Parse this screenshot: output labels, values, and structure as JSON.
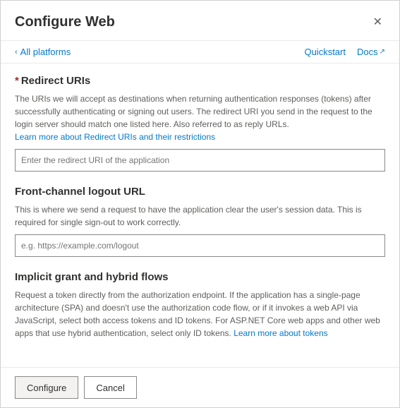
{
  "dialog": {
    "title": "Configure Web",
    "close_label": "✕"
  },
  "nav": {
    "back_chevron": "‹",
    "back_label": "All platforms",
    "quickstart_label": "Quickstart",
    "docs_label": "Docs",
    "external_icon": "↗"
  },
  "sections": {
    "redirect_uris": {
      "required_star": "*",
      "title": "Redirect URIs",
      "description": "The URIs we will accept as destinations when returning authentication responses (tokens) after successfully authenticating or signing out users. The redirect URI you send in the request to the login server should match one listed here. Also referred to as reply URLs.",
      "learn_more_text": "Learn more about Redirect URIs and their restrictions",
      "input_placeholder": "Enter the redirect URI of the application"
    },
    "front_channel": {
      "title": "Front-channel logout URL",
      "description": "This is where we send a request to have the application clear the user's session data. This is required for single sign-out to work correctly.",
      "input_placeholder": "e.g. https://example.com/logout"
    },
    "implicit_grant": {
      "title": "Implicit grant and hybrid flows",
      "description": "Request a token directly from the authorization endpoint. If the application has a single-page architecture (SPA) and doesn't use the authorization code flow, or if it invokes a web API via JavaScript, select both access tokens and ID tokens. For ASP.NET Core web apps and other web apps that use hybrid authentication, select only ID tokens.",
      "learn_more_text": "Learn more about tokens"
    }
  },
  "footer": {
    "configure_label": "Configure",
    "cancel_label": "Cancel"
  }
}
